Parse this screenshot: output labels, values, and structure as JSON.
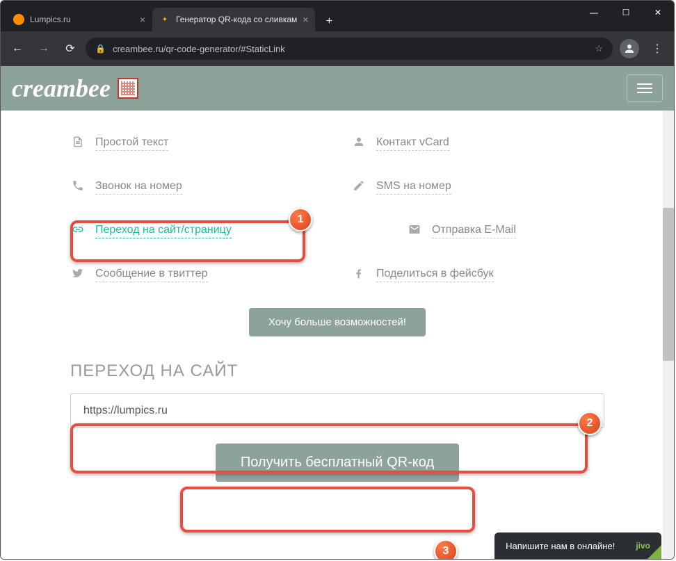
{
  "browser": {
    "tabs": [
      {
        "title": "Lumpics.ru",
        "active": false
      },
      {
        "title": "Генератор QR-кода со сливкам",
        "active": true
      }
    ],
    "url": "creambee.ru/qr-code-generator/#StaticLink"
  },
  "header": {
    "logo": "creambee"
  },
  "options": {
    "text": "Простой текст",
    "vcard": "Контакт vCard",
    "call": "Звонок на номер",
    "sms": "SMS на номер",
    "link": "Переход на сайт/страницу",
    "email": "Отправка E-Mail",
    "twitter": "Сообщение в твиттер",
    "facebook": "Поделиться в фейсбук"
  },
  "more_button": "Хочу больше возможностей!",
  "section_title": "ПЕРЕХОД НА САЙТ",
  "url_input_value": "https://lumpics.ru",
  "get_button": "Получить бесплатный QR-код",
  "jivo": {
    "text": "Напишите нам    в онлайне!",
    "brand": "jivo"
  },
  "badges": {
    "b1": "1",
    "b2": "2",
    "b3": "3"
  }
}
